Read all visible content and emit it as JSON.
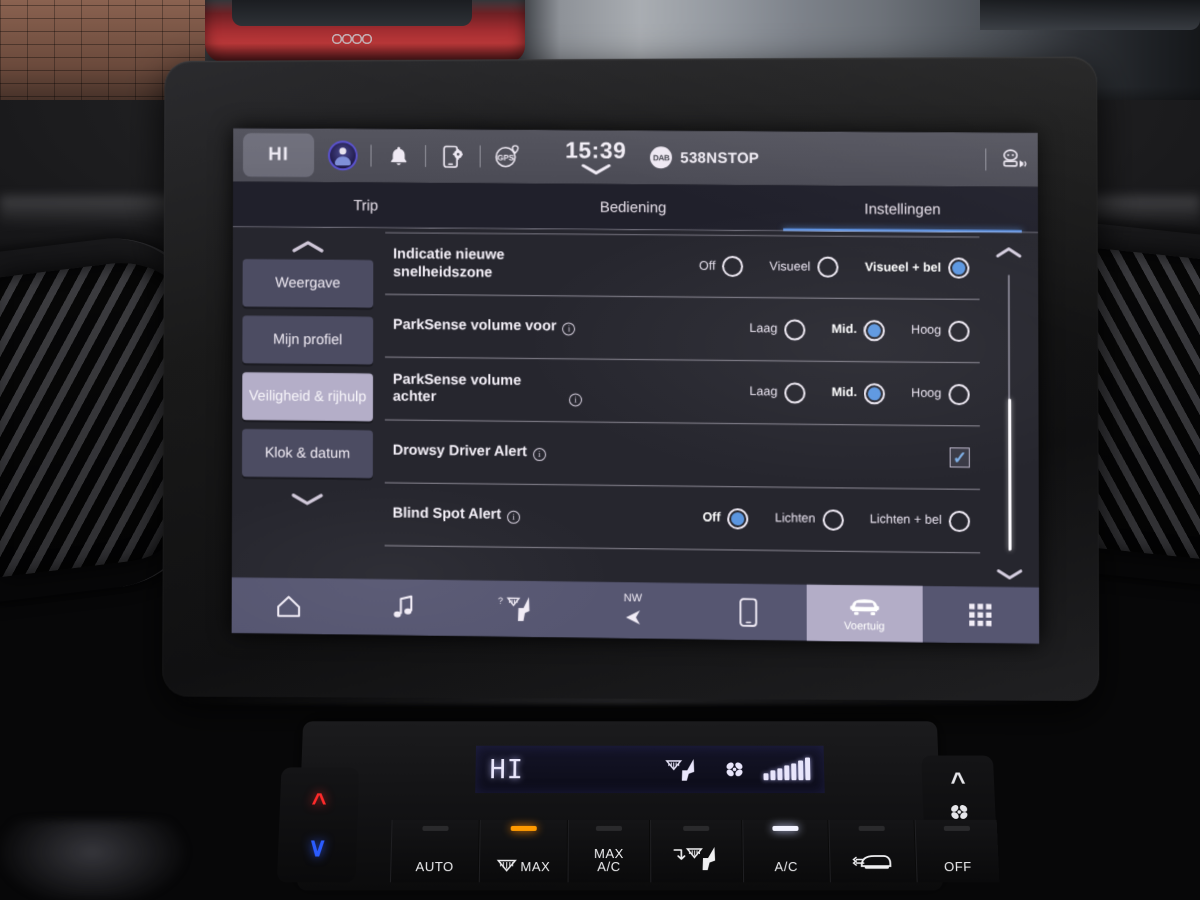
{
  "statusbar": {
    "hi_badge": "HI",
    "avatar_icon": "user-avatar-icon",
    "bell_icon": "bell-icon",
    "phone_settings_icon": "phone-settings-icon",
    "gps_icon": "gps-icon",
    "gps_label": "GPS",
    "clock": "15:39",
    "chevron_icon": "chevron-down-icon",
    "radio_band": "DAB",
    "radio_station": "538NSTOP",
    "voice_icon": "voice-assistant-icon"
  },
  "tabs": [
    {
      "label": "Trip",
      "active": false
    },
    {
      "label": "Bediening",
      "active": false
    },
    {
      "label": "Instellingen",
      "active": true
    }
  ],
  "sidebar": {
    "scroll_up_icon": "chevron-up-icon",
    "scroll_down_icon": "chevron-down-icon",
    "items": [
      {
        "label": "Weergave",
        "active": false
      },
      {
        "label": "Mijn profiel",
        "active": false
      },
      {
        "label": "Veiligheid & rijhulp",
        "active": true
      },
      {
        "label": "Klok & datum",
        "active": false
      }
    ]
  },
  "settings_rows": [
    {
      "label": "Indicatie nieuwe snelheidszone",
      "info": false,
      "control": "radio",
      "options": [
        {
          "label": "Off",
          "selected": false
        },
        {
          "label": "Visueel",
          "selected": false
        },
        {
          "label": "Visueel + bel",
          "selected": true
        }
      ]
    },
    {
      "label": "ParkSense volume voor",
      "info": true,
      "control": "radio",
      "options": [
        {
          "label": "Laag",
          "selected": false
        },
        {
          "label": "Mid.",
          "selected": true
        },
        {
          "label": "Hoog",
          "selected": false
        }
      ]
    },
    {
      "label": "ParkSense volume achter",
      "info": true,
      "control": "radio",
      "options": [
        {
          "label": "Laag",
          "selected": false
        },
        {
          "label": "Mid.",
          "selected": true
        },
        {
          "label": "Hoog",
          "selected": false
        }
      ]
    },
    {
      "label": "Drowsy Driver Alert",
      "info": true,
      "control": "checkbox",
      "checked": true,
      "check_glyph": "✓"
    },
    {
      "label": "Blind Spot Alert",
      "info": true,
      "control": "radio",
      "options": [
        {
          "label": "Off",
          "selected": true
        },
        {
          "label": "Lichten",
          "selected": false
        },
        {
          "label": "Lichten + bel",
          "selected": false
        }
      ]
    }
  ],
  "content_scrollbar": {
    "up_icon": "chevron-up-icon",
    "down_icon": "chevron-down-icon",
    "thumb_top_pct": 45,
    "thumb_height_pct": 55
  },
  "bottom_nav": [
    {
      "label": "",
      "icon": "home-icon",
      "active": false
    },
    {
      "label": "",
      "icon": "music-note-icon",
      "active": false
    },
    {
      "label": "",
      "icon": "climate-seat-icon",
      "active": false
    },
    {
      "label": "NW",
      "icon": "navigation-arrow-icon",
      "active": false
    },
    {
      "label": "",
      "icon": "phone-icon",
      "active": false
    },
    {
      "label": "Voertuig",
      "icon": "vehicle-car-icon",
      "active": true
    },
    {
      "label": "",
      "icon": "apps-grid-icon",
      "active": false
    }
  ],
  "hvac": {
    "temp_display": "HI",
    "defrost_icon": "defrost-windshield-icon",
    "fan_icon": "fan-icon",
    "fan_bars": 7,
    "fan_bars_total": 7,
    "temp_up_icon": "chevron-up-icon",
    "temp_down_icon": "chevron-down-icon",
    "fan_up_icon": "chevron-up-icon",
    "fan_down_icon": "chevron-down-icon",
    "buttons": [
      {
        "label": "AUTO",
        "icon": "",
        "led": "off"
      },
      {
        "label": "MAX",
        "icon": "defrost-front-icon",
        "led": "amber"
      },
      {
        "label": "MAX A/C",
        "icon": "",
        "led": "off"
      },
      {
        "label": "",
        "icon": "airflow-direction-icon",
        "led": "off"
      },
      {
        "label": "A/C",
        "icon": "",
        "led": "white"
      },
      {
        "label": "",
        "icon": "rear-defrost-icon",
        "led": "off"
      },
      {
        "label": "OFF",
        "icon": "",
        "led": "off"
      }
    ]
  },
  "colors": {
    "accent_blue": "#5b96e0",
    "tab_underline": "#5a8fe0",
    "sidebar_button": "#4c4c62",
    "sidebar_active": "#b4aec8",
    "statusbar_bg": "#55555f",
    "body_bg": "#26262e",
    "nav_bg": "#565671",
    "nav_active": "#b3adc7"
  }
}
